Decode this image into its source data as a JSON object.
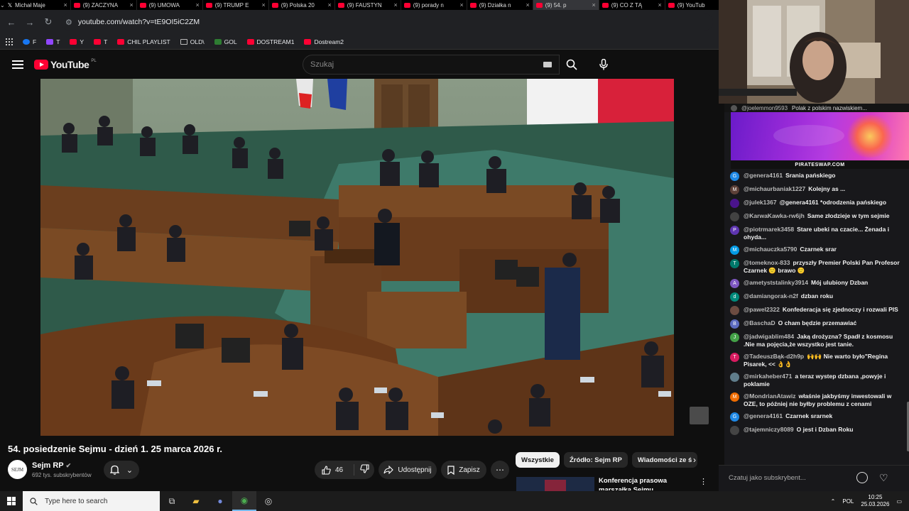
{
  "tabs": [
    {
      "label": "Michał Maje",
      "fav": "x"
    },
    {
      "label": "(9) ZACZYNA",
      "fav": "yt"
    },
    {
      "label": "(9) UMOWA",
      "fav": "yt"
    },
    {
      "label": "(9) TRUMP E",
      "fav": "yt"
    },
    {
      "label": "(9) Polska 20",
      "fav": "yt"
    },
    {
      "label": "(9) FAUSTYN",
      "fav": "yt"
    },
    {
      "label": "(9) porady n",
      "fav": "yt"
    },
    {
      "label": "(9) Działka n",
      "fav": "yt"
    },
    {
      "label": "(9) 54. p",
      "fav": "yt",
      "active": true
    },
    {
      "label": "(9) CO Z TĄ",
      "fav": "yt"
    },
    {
      "label": "(9) YouTub",
      "fav": "yt"
    }
  ],
  "address": {
    "url": "youtube.com/watch?v=tE9OI5iC2ZM"
  },
  "bookmarks": [
    {
      "label": "F",
      "icon": "facebook-icon"
    },
    {
      "label": "T",
      "icon": "twitch-icon"
    },
    {
      "label": "Y",
      "icon": "youtube-icon"
    },
    {
      "label": "T",
      "icon": "x-icon"
    },
    {
      "label": "CHIL PLAYLIST",
      "icon": "youtube-icon"
    },
    {
      "label": "OLD\\",
      "icon": "folder-icon"
    },
    {
      "label": "GOL",
      "icon": "gol-icon"
    },
    {
      "label": "DOSTREAM1",
      "icon": "youtube-icon"
    },
    {
      "label": "Dostream2",
      "icon": "youtube-icon"
    }
  ],
  "yt": {
    "logo_text": "YouTube",
    "country": "PL",
    "search_placeholder": "Szukaj"
  },
  "video": {
    "title": "54. posiedzenie Sejmu - dzień 1. 25 marca 2026 r.",
    "channel": "Sejm RP",
    "channel_avatar_text": "SEJM",
    "subscribers": "692 tys. subskrybentów",
    "likes": "46",
    "share_label": "Udostępnij",
    "save_label": "Zapisz"
  },
  "chips": [
    "Wszystkie",
    "Źródło: Sejm RP",
    "Wiadomości ze ś"
  ],
  "related": {
    "title": "Konferencja prasowa marszałka Sejmu Włodzimierza"
  },
  "chat": {
    "pinned_user": "@joelemmon9593",
    "pinned_text": "Polak z polskim nazwiskiem...",
    "banner_caption": "PIRATESWAP.COM",
    "input_placeholder": "Czatuj jako subskrybent...",
    "messages": [
      {
        "initial": "G",
        "color": "#1e88e5",
        "user": "@genera4161",
        "text": "Srania pańskiego"
      },
      {
        "initial": "M",
        "color": "#5d4037",
        "user": "@michaurbaniak1227",
        "text": "Kolejny as ..."
      },
      {
        "initial": "",
        "color": "#4a148c",
        "user": "@julek1367",
        "text": "@genera4161 *odrodzenia pańskiego"
      },
      {
        "initial": "",
        "color": "#424242",
        "user": "@KarwaKawka-rw6jh",
        "text": "Same złodzieje w tym sejmie"
      },
      {
        "initial": "P",
        "color": "#5e35b1",
        "user": "@piotrmarek3458",
        "text": "Stare ubeki na czacie... Żenada i ohyda..."
      },
      {
        "initial": "M",
        "color": "#039be5",
        "user": "@michauczka5790",
        "text": "Czarnek srar"
      },
      {
        "initial": "T",
        "color": "#00796b",
        "user": "@tomeknox-833",
        "text": "przyszły Premier Polski Pan Profesor Czarnek 🙂 brawo 🙂"
      },
      {
        "initial": "A",
        "color": "#7e57c2",
        "user": "@ametyststalinky3914",
        "text": "Mój ulubiony Dzban"
      },
      {
        "initial": "d",
        "color": "#00897b",
        "user": "@damiangorak-n2f",
        "text": "dzban roku"
      },
      {
        "initial": "",
        "color": "#6d4c41",
        "user": "@pawel2322",
        "text": "Konfederacja się zjednoczy i rozwali PIS"
      },
      {
        "initial": "B",
        "color": "#5c6bc0",
        "user": "@BaschaD",
        "text": "O cham będzie przemawiać"
      },
      {
        "initial": "J",
        "color": "#43a047",
        "user": "@jadwigablim484",
        "text": "Jaką drożyzna? Spadł z kosmosu .Nie ma pojęcia,że wszystko jest tanie."
      },
      {
        "initial": "T",
        "color": "#d81b60",
        "user": "@TadeuszBąk-d2h9p",
        "text": "🙌🙌 Nie warto było\"Regina Pisarek, << 👌👌"
      },
      {
        "initial": "",
        "color": "#607d8b",
        "user": "@mirkaheber471",
        "text": "a teraz wystep dzbana ,powyje i poklamie"
      },
      {
        "initial": "M",
        "color": "#ef6c00",
        "user": "@MondrianAtawiz",
        "text": "właśnie jakbyśmy inwestowali w OZE, to później nie byłby problemu z cenami"
      },
      {
        "initial": "G",
        "color": "#1e88e5",
        "user": "@genera4161",
        "text": "Czarnek srarnek"
      },
      {
        "initial": "",
        "color": "#444444",
        "user": "@tajemniczy8089",
        "text": "O jest i Dzban Roku"
      }
    ]
  },
  "taskbar": {
    "search_placeholder": "Type here to search",
    "lang": "POL",
    "time": "10:25",
    "date": "25.03.2026"
  }
}
